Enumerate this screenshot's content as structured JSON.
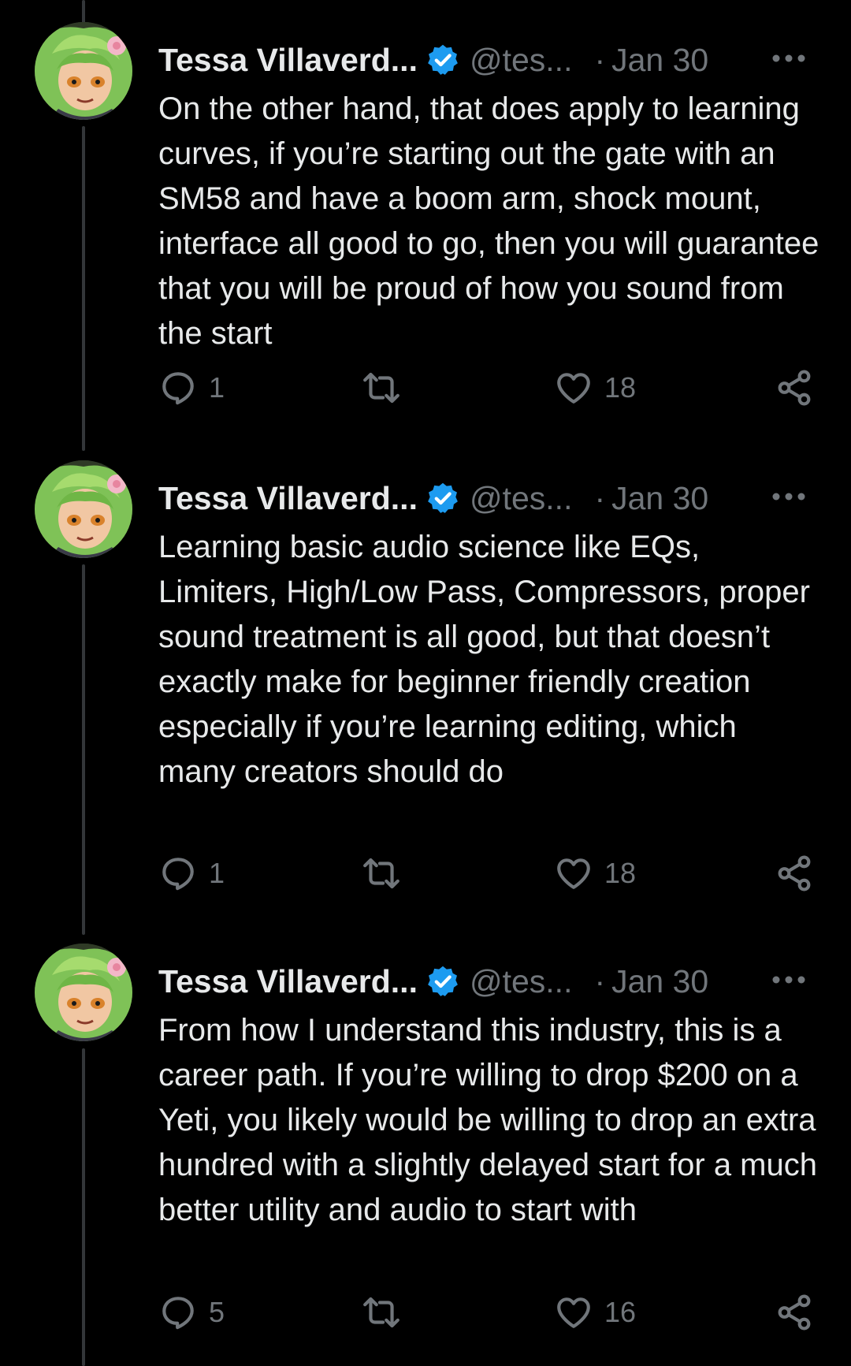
{
  "colors": {
    "background": "#000000",
    "text": "#e7e9ea",
    "secondary": "#71767b",
    "verified": "#1d9bf0",
    "thread_line": "#333639"
  },
  "tweets": [
    {
      "display_name": "Tessa Villaverd...",
      "handle": "@tes...",
      "separator": "·",
      "date": "Jan 30",
      "text": "On the other hand, that does apply to learning curves, if you’re starting out the gate with an SM58 and have a boom arm, shock mount, interface all good to go, then you will guarantee that you will be proud of how you sound from the start",
      "replies": "1",
      "reposts": "",
      "likes": "18"
    },
    {
      "display_name": "Tessa Villaverd...",
      "handle": "@tes...",
      "separator": "·",
      "date": "Jan 30",
      "text": "Learning basic audio science like EQs, Limiters, High/Low Pass, Compressors, proper sound treatment is all good, but that doesn’t exactly make for beginner friendly creation especially if you’re learning editing, which many creators should do",
      "replies": "1",
      "reposts": "",
      "likes": "18"
    },
    {
      "display_name": "Tessa Villaverd...",
      "handle": "@tes...",
      "separator": "·",
      "date": "Jan 30",
      "text": "From how I understand this industry, this is a career path. If you’re willing to drop $200 on a Yeti, you likely would be willing to drop an extra hundred with a slightly delayed start for a much better utility and audio to start with",
      "replies": "5",
      "reposts": "",
      "likes": "16"
    }
  ],
  "icons": {
    "avatar": "avatar-icon",
    "verified": "verified-badge-icon",
    "more": "more-options-icon",
    "reply": "reply-icon",
    "repost": "repost-icon",
    "like": "heart-icon",
    "share": "share-icon"
  }
}
